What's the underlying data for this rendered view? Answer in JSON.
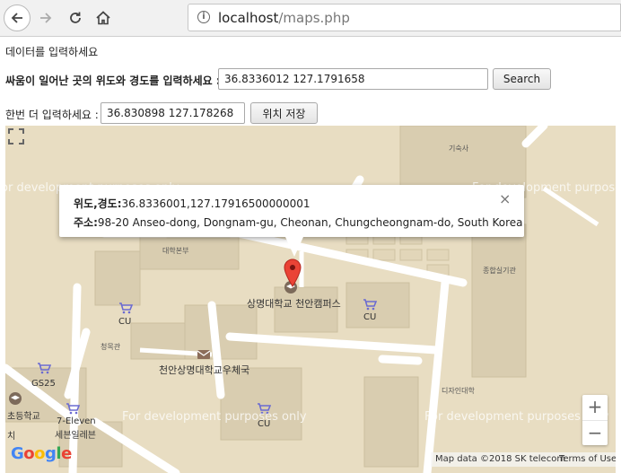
{
  "browser": {
    "url_host": "localhost",
    "url_path": "/maps.php"
  },
  "page": {
    "intro": "데이터를 입력하세요",
    "coord_label": "싸움이 일어난 곳의 위도와 경도를 입력하세요 :",
    "coord_value": "36.8336012 127.1791658",
    "search_label": "Search",
    "again_label": "한번 더 입력하세요 :",
    "again_value": "36.830898 127.178268",
    "save_label": "위치 저장"
  },
  "map": {
    "infowindow": {
      "coord_key": "위도,경도:",
      "coord_value": "36.8336001,127.17916500000001",
      "addr_key": "주소:",
      "addr_value": "98-20 Anseo-dong, Dongnam-gu, Cheonan, Chungcheongnam-do, South Korea",
      "close": "×"
    },
    "labels": {
      "dorm": "기숙사",
      "main_bldg": "대학본부",
      "sports": "종합실기관",
      "library": "청목관",
      "campus": "상명대학교 천안캠퍼스",
      "post": "천안상명대학교우체국",
      "design": "디자인대학",
      "cu1": "CU",
      "cu2": "CU",
      "cu3": "CU",
      "gs25": "GS25",
      "school": "초등학교",
      "seven_en": "7-Eleven",
      "seven_kr": "세븐일레븐",
      "chi": "치"
    },
    "watermark": "For development purposes only",
    "zoom_in": "+",
    "zoom_out": "−",
    "google": "Google",
    "map_data": "Map data ©2018 SK telecom",
    "terms": "Terms of Use"
  },
  "colors": {
    "campus_fill": "#e8ddc2",
    "building": "#d9cdb0",
    "road": "#ffffff",
    "pin": "#ea4335",
    "google_blue": "#4285f4",
    "google_red": "#ea4335",
    "google_yellow": "#fbbc05",
    "google_green": "#34a853"
  }
}
